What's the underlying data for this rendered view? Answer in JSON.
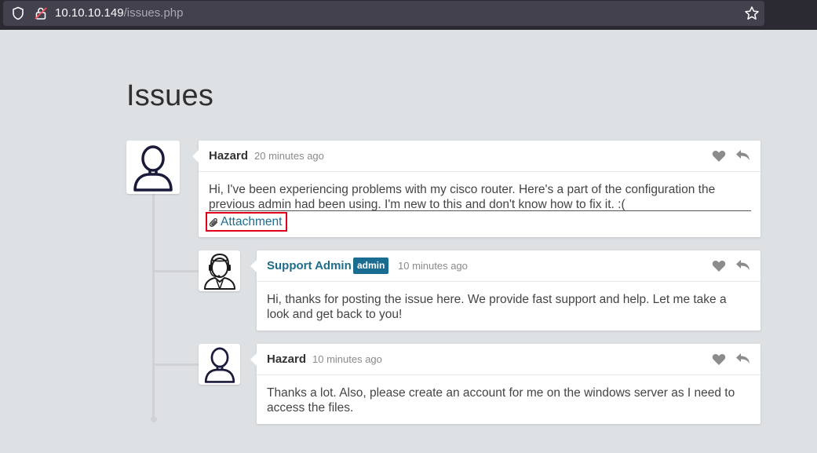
{
  "browser": {
    "url_host": "10.10.10.149",
    "url_path": "/issues.php"
  },
  "page": {
    "title": "Issues"
  },
  "comments": [
    {
      "author": "Hazard",
      "time_ago": "20 minutes ago",
      "text": "Hi, I've been experiencing problems with my cisco router. Here's a part of the configuration the previous admin had been using. I'm new to this and don't know how to fix it. :(",
      "attachment_label": "Attachment"
    },
    {
      "author": "Support Admin",
      "badge": "admin",
      "time_ago": "10 minutes ago",
      "text": "Hi, thanks for posting the issue here. We provide fast support and help. Let me take a look and get back to you!"
    },
    {
      "author": "Hazard",
      "time_ago": "10 minutes ago",
      "text": "Thanks a lot. Also, please create an account for me on the windows server as I need to access the files."
    }
  ],
  "colors": {
    "background": "#dee1e4",
    "link": "#1d6c8c",
    "badge": "#1a6c90",
    "highlight_box": "#e0001a"
  }
}
